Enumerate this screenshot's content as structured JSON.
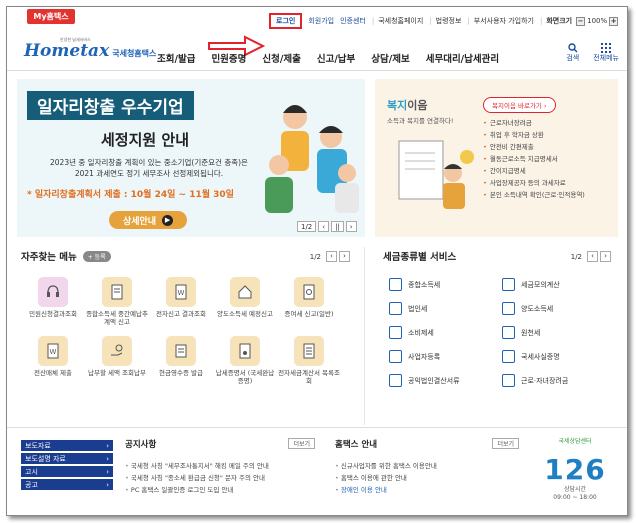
{
  "topbar": {
    "my_tab": "My홈택스",
    "links": [
      "회원가입",
      "인증센터",
      "국세청홈페이지",
      "법령정보",
      "부서사용자 가입하기",
      "화면크기"
    ],
    "login": "로그인",
    "zoom_minus": "−",
    "zoom_value": "100%",
    "zoom_plus": "+"
  },
  "header": {
    "logo_main": "Hometax",
    "logo_sub": "국세청홈택스",
    "logo_tagline": "안녕한 납세서비스",
    "nav": [
      "조회/발급",
      "민원증명",
      "신청/제출",
      "신고/납부",
      "상담/제보",
      "세무대리/납세관리"
    ],
    "search_label": "검색",
    "menu_label": "전체메뉴"
  },
  "banner": {
    "title": "일자리창출 우수기업",
    "subtitle": "세정지원 안내",
    "desc_line1": "2023년 중 일자리창출 계획이 있는 중소기업(기준요건 충족)은",
    "desc_line2": "2021 과세연도 정기 세무조사 선정제외됩니다.",
    "deadline_label": "* 일자리창출계획서 제출 : ",
    "deadline_value": "10월 24일 ~ 11월 30일",
    "button": "상세안내",
    "page": "1/2"
  },
  "welfare": {
    "title_a": "복지",
    "title_b": "이음",
    "subtitle": "소득과 복지를 연결하다!",
    "button": "복지이음 바로가기",
    "items": [
      "근로자녀장려금",
      "취업 후 학자금 상환",
      "안전비 간편제출",
      "월동근로소득 지급명세서",
      "간이지급명세",
      "사업장제공자 등의 과세자료",
      "본인 소득내역 확인(근로·인적용역)"
    ]
  },
  "frequent": {
    "title": "자주찾는 메뉴",
    "register": "+ 등록",
    "page": "1/2",
    "items": [
      "민원신청결과조회",
      "종합소득세 중간예납추계액 신고",
      "전자신고 결과조회",
      "양도소득세 예정신고",
      "증여세 신고(일반)",
      "전산매체 제출",
      "납부할 세액 조회납부",
      "현금영수증 발급",
      "납세증명서 (국세완납증명)",
      "전자세금계산서 목록조회"
    ]
  },
  "tax_service": {
    "title": "세금종류별 서비스",
    "page": "1/2",
    "items": [
      "종합소득세",
      "세금모의계산",
      "법인세",
      "양도소득세",
      "소비제세",
      "원천세",
      "사업자등록",
      "국세사실증명",
      "공익법인결산서류",
      "근로·자녀장려금"
    ]
  },
  "bottom": {
    "data_links": [
      "보도자료",
      "보도설명 자료",
      "고시",
      "공고"
    ],
    "notice_title": "공지사항",
    "notice_more": "더보기",
    "notices": [
      "국세청 사칭 \"세무조사통지서\" 해킹 메일 주의 안내",
      "국세청 사칭 \"종소세 환급금 신청\" 문자 주의 안내",
      "PC 홈택스 일괄인증 로그인 도입 안내"
    ],
    "guide_title": "홈택스 안내",
    "guide_more": "더보기",
    "guides": [
      "신규사업자를 위한 홈택스 이용안내",
      "홈택스 이용에 관한 안내",
      "장애인 이용 안내"
    ],
    "call_top": "국세상담센터",
    "call_number": "126",
    "call_hours_label": "상담시간",
    "call_hours": "09:00 ~ 18:00"
  },
  "colors": {
    "brand_blue": "#1f63b6",
    "red": "#e2232b",
    "banner_bg": "#edf6f9",
    "welfare_bg": "#fbf3e6"
  }
}
